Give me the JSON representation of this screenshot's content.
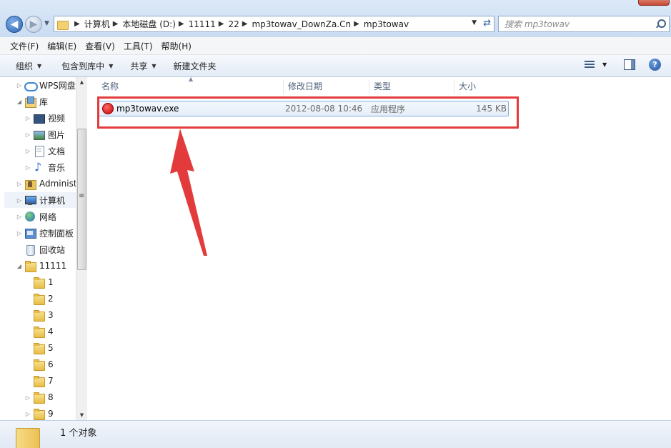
{
  "search": {
    "placeholder": "搜索 mp3towav"
  },
  "address": {
    "crumbs": [
      "计算机",
      "本地磁盘 (D:)",
      "11111",
      "22",
      "mp3towav_DownZa.Cn",
      "mp3towav"
    ]
  },
  "menu": [
    "文件(F)",
    "编辑(E)",
    "查看(V)",
    "工具(T)",
    "帮助(H)"
  ],
  "commands": {
    "organize": "组织",
    "include_library": "包含到库中",
    "share": "共享",
    "new_folder": "新建文件夹"
  },
  "nav_tree": [
    {
      "label": "WPS网盘",
      "icon": "cloud-icon"
    },
    {
      "label": "库",
      "icon": "library-icon"
    },
    {
      "label": "视频",
      "icon": "video-library-icon"
    },
    {
      "label": "图片",
      "icon": "pictures-library-icon"
    },
    {
      "label": "文档",
      "icon": "documents-library-icon"
    },
    {
      "label": "音乐",
      "icon": "music-library-icon"
    },
    {
      "label": "Administ",
      "icon": "user-folder-icon"
    },
    {
      "label": "计算机",
      "icon": "computer-icon"
    },
    {
      "label": "网络",
      "icon": "network-icon"
    },
    {
      "label": "控制面板",
      "icon": "control-panel-icon"
    },
    {
      "label": "回收站",
      "icon": "recycle-bin-icon"
    },
    {
      "label": "11111",
      "icon": "folder-icon"
    },
    {
      "label": "1",
      "icon": "folder-icon"
    },
    {
      "label": "2",
      "icon": "folder-icon"
    },
    {
      "label": "3",
      "icon": "folder-icon"
    },
    {
      "label": "4",
      "icon": "folder-icon"
    },
    {
      "label": "5",
      "icon": "folder-icon"
    },
    {
      "label": "6",
      "icon": "folder-icon"
    },
    {
      "label": "7",
      "icon": "folder-icon"
    },
    {
      "label": "8",
      "icon": "folder-icon"
    },
    {
      "label": "9",
      "icon": "folder-icon"
    }
  ],
  "columns": {
    "name": "名称",
    "date": "修改日期",
    "type": "类型",
    "size": "大小"
  },
  "files": [
    {
      "name": "mp3towav.exe",
      "date": "2012-08-08 10:46",
      "type": "应用程序",
      "size": "145 KB",
      "icon": "exe-icon"
    }
  ],
  "status": {
    "text": "1 个对象"
  },
  "colors": {
    "annotation": "#e33b3b",
    "selection_border": "#84acdd"
  }
}
